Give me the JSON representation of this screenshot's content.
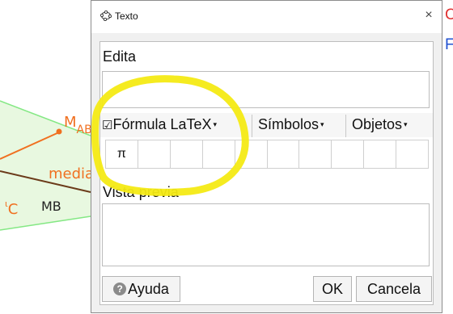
{
  "background": {
    "labels": {
      "m_ab_main": "M",
      "m_ab_sub": "AB",
      "media": "media",
      "c_sub": "C",
      "mb": "MB",
      "right_top": "C",
      "right_mid": "F"
    },
    "colors": {
      "region": "#e6f7df",
      "lines": "#7ee87e",
      "orange": "#f07020",
      "brown": "#6b3b1a"
    }
  },
  "dialog": {
    "title": "Texto",
    "close_glyph": "×",
    "edit_label": "Edita",
    "toolbar": {
      "latex_check": "☑",
      "latex_label": "Fórmula LaTeX",
      "symbols_label": "Símbolos",
      "objects_label": "Objetos",
      "caret": "▾"
    },
    "symbols": [
      "π",
      "",
      "",
      "",
      "",
      "",
      "",
      "",
      "",
      ""
    ],
    "preview_label": "Vista previa",
    "buttons": {
      "help": "Ayuda",
      "help_icon": "?",
      "ok": "OK",
      "cancel": "Cancela"
    }
  },
  "highlight_color": "#f4ea14"
}
